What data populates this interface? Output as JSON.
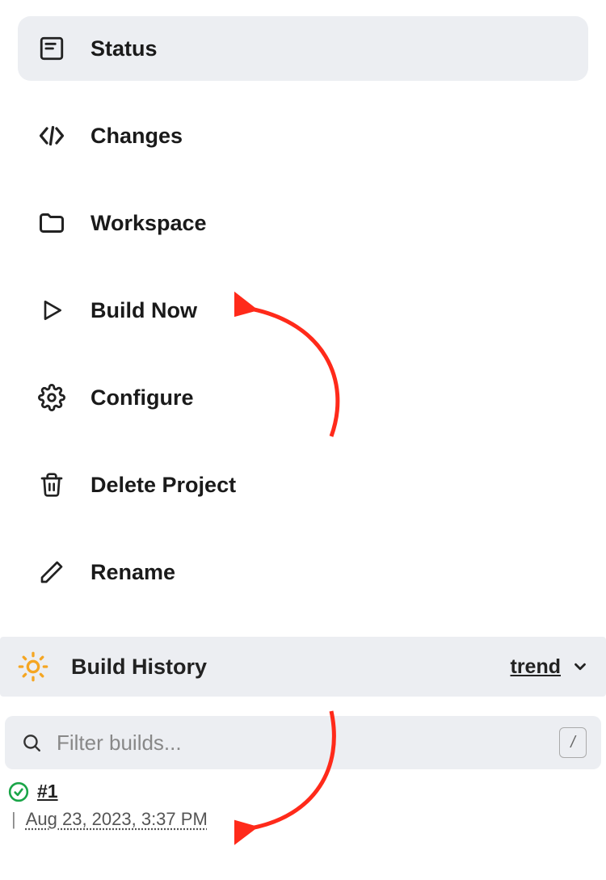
{
  "nav": {
    "items": [
      {
        "label": "Status",
        "icon": "status-icon",
        "active": true
      },
      {
        "label": "Changes",
        "icon": "code-icon",
        "active": false
      },
      {
        "label": "Workspace",
        "icon": "folder-icon",
        "active": false
      },
      {
        "label": "Build Now",
        "icon": "play-icon",
        "active": false
      },
      {
        "label": "Configure",
        "icon": "gear-icon",
        "active": false
      },
      {
        "label": "Delete Project",
        "icon": "trash-icon",
        "active": false
      },
      {
        "label": "Rename",
        "icon": "pencil-icon",
        "active": false
      }
    ]
  },
  "history": {
    "title": "Build History",
    "trend_label": "trend"
  },
  "filter": {
    "placeholder": "Filter builds...",
    "shortcut_key": "/"
  },
  "builds": [
    {
      "status": "success",
      "number_label": "#1",
      "date_label": "Aug 23, 2023, 3:37 PM"
    }
  ],
  "colors": {
    "accent_orange": "#f5a623",
    "success_green": "#1aa548",
    "annotation_red": "#ff2a1a"
  }
}
